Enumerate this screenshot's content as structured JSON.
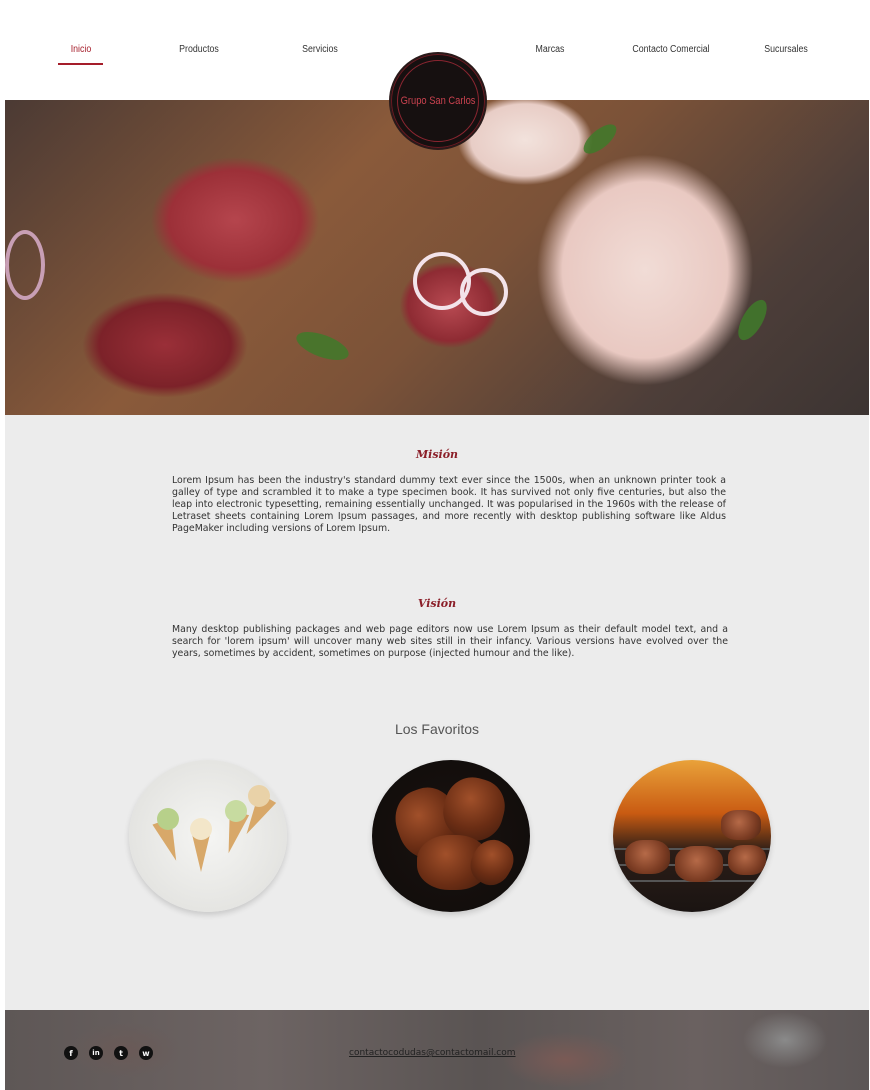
{
  "nav": {
    "items": [
      {
        "label": "Inicio",
        "active": true
      },
      {
        "label": "Productos",
        "active": false
      },
      {
        "label": "Servicios",
        "active": false
      },
      {
        "label": "Marcas",
        "active": false
      },
      {
        "label": "Contacto Comercial",
        "active": false
      },
      {
        "label": "Sucursales",
        "active": false
      }
    ],
    "accent_color": "#a51d2a"
  },
  "logo": {
    "text": "Grupo San Carlos"
  },
  "mission": {
    "title": "Misión",
    "text": "Lorem Ipsum has been the industry's standard dummy text ever since the 1500s, when an unknown printer took a galley of type and scrambled it to make a type specimen book. It has survived not only five centuries, but also the leap into electronic typesetting, remaining essentially unchanged. It was popularised in the 1960s with the release of Letraset sheets containing Lorem Ipsum passages, and more recently with desktop publishing software like Aldus PageMaker including versions of Lorem Ipsum."
  },
  "vision": {
    "title": "Visión",
    "text": "Many desktop publishing packages and web page editors now use Lorem Ipsum as their default model text, and a search for 'lorem ipsum' will uncover many web sites still in their infancy. Various versions have evolved over the years, sometimes by accident, sometimes on purpose (injected humour and the like)."
  },
  "favorites": {
    "title": "Los Favoritos",
    "items": [
      {
        "icon": "ice-cream-image"
      },
      {
        "icon": "roast-chicken-image"
      },
      {
        "icon": "grilled-steak-image"
      }
    ]
  },
  "footer": {
    "social": [
      {
        "icon": "facebook-icon",
        "glyph": "f"
      },
      {
        "icon": "linkedin-icon",
        "glyph": "in"
      },
      {
        "icon": "twitter-icon",
        "glyph": "t"
      },
      {
        "icon": "whatsapp-icon",
        "glyph": "w"
      }
    ],
    "email": "contactocodudas@contactomail.com"
  }
}
